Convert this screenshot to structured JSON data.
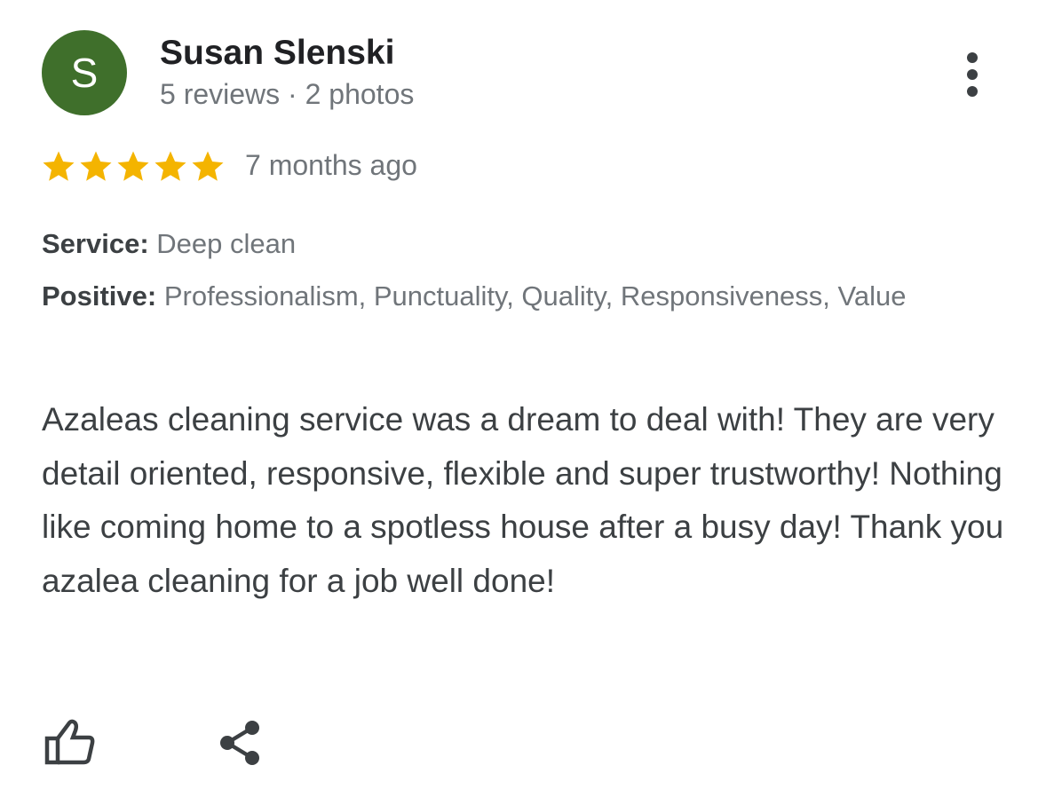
{
  "reviewer": {
    "avatar_letter": "S",
    "avatar_color": "#3f6f2b",
    "name": "Susan Slenski",
    "meta": "5 reviews · 2 photos"
  },
  "rating": {
    "stars": 5,
    "max_stars": 5,
    "star_color": "#f4b400",
    "time_ago": "7 months ago"
  },
  "attributes": {
    "service_label": "Service:",
    "service_value": "Deep clean",
    "positive_label": "Positive:",
    "positive_value": "Professionalism, Punctuality, Quality, Responsiveness, Value"
  },
  "review_text": "Azaleas cleaning service was a dream to deal with! They are very detail oriented, responsive, flexible and super trustworthy! Nothing like coming home to a spotless house after a busy day! Thank you azalea cleaning for a job well done!",
  "actions": {
    "more_icon": "more-vert-icon",
    "like_icon": "thumb-up-icon",
    "share_icon": "share-icon"
  }
}
